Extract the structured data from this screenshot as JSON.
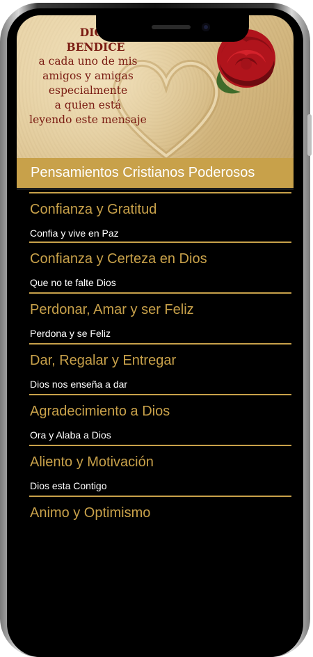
{
  "banner": {
    "lines": [
      "DIOS",
      "BENDICE",
      "a cada uno de mis",
      "amigos y amigas",
      "especialmente",
      "a quien está",
      "leyendo este mensaje"
    ]
  },
  "app": {
    "title": "Pensamientos Cristianos Poderosos"
  },
  "items": [
    {
      "title": "Confianza y Gratitud",
      "subtitle": "Confia y vive en Paz"
    },
    {
      "title": "Confianza y Certeza en Dios",
      "subtitle": "Que no te falte Dios"
    },
    {
      "title": "Perdonar, Amar y ser Feliz",
      "subtitle": "Perdona y se Feliz"
    },
    {
      "title": "Dar, Regalar y Entregar",
      "subtitle": "Dios nos enseña a dar"
    },
    {
      "title": "Agradecimiento a Dios",
      "subtitle": "Ora y Alaba a Dios"
    },
    {
      "title": "Aliento y Motivación",
      "subtitle": "Dios esta Contigo"
    },
    {
      "title": "Animo y Optimismo",
      "subtitle": ""
    }
  ],
  "colors": {
    "accent": "#c8a14a",
    "background": "#000000",
    "text": "#ffffff",
    "banner_text": "#7a1b12"
  }
}
